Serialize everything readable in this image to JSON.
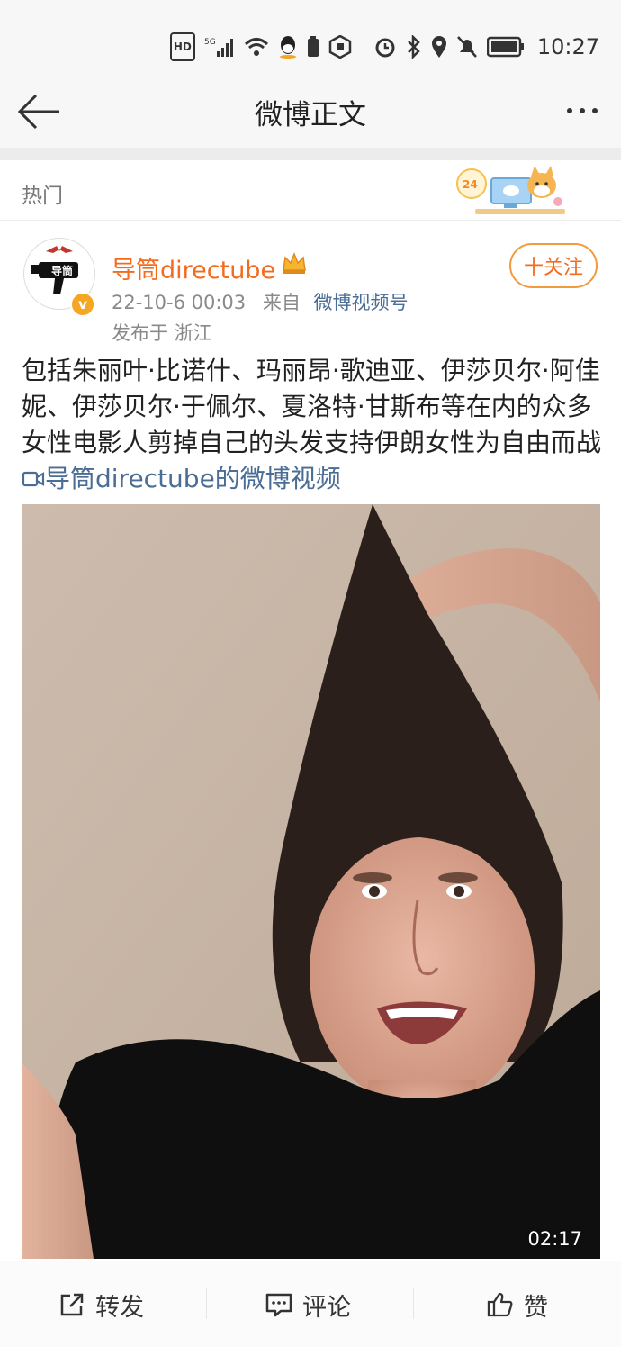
{
  "status_bar": {
    "hd": "HD",
    "network": "5G",
    "time": "10:27"
  },
  "nav": {
    "title": "微博正文"
  },
  "hot": {
    "label": "热门",
    "badge": "24"
  },
  "post": {
    "author": "导筒directube",
    "avatar_text": "导筒",
    "verified_mark": "v",
    "timestamp": "22-10-6 00:03",
    "from_label": "来自",
    "source": "微博视频号",
    "location": "发布于 浙江",
    "follow_label": "十关注",
    "text": "包括朱丽叶·比诺什、玛丽昂·歌迪亚、伊莎贝尔·阿佳妮、伊莎贝尔·于佩尔、夏洛特·甘斯布等在内的众多女性电影人剪掉自己的头发支持伊朗女性为自由而战",
    "video_link": "导筒directube的微博视频",
    "video_duration": "02:17"
  },
  "actions": {
    "repost": "转发",
    "comment": "评论",
    "like": "赞"
  },
  "colors": {
    "accent_orange": "#f36b1c",
    "link_blue": "#4a6d95"
  }
}
